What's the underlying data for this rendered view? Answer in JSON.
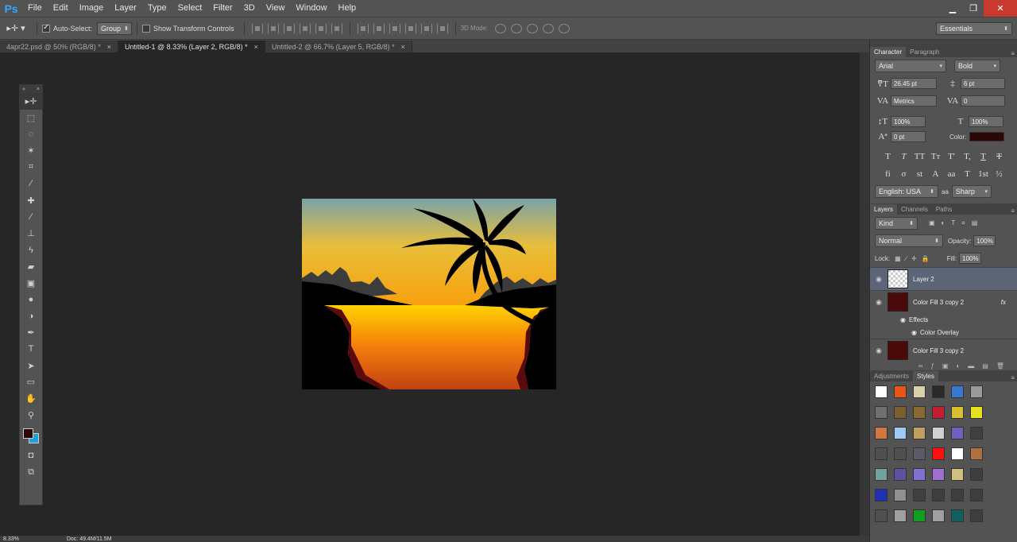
{
  "app": {
    "logo": "Ps"
  },
  "menu": [
    "File",
    "Edit",
    "Image",
    "Layer",
    "Type",
    "Select",
    "Filter",
    "3D",
    "View",
    "Window",
    "Help"
  ],
  "window_controls": {
    "minimize": "▁",
    "restore": "❐",
    "close": "✕"
  },
  "options": {
    "auto_select_label": "Auto-Select:",
    "auto_select_value": "Group",
    "transform_label": "Show Transform Controls",
    "mode3d_label": "3D Mode:",
    "workspace": "Essentials"
  },
  "tabs": [
    {
      "label": "4apr22.psd @ 50% (RGB/8) *"
    },
    {
      "label": "Untitled-1 @ 8.33% (Layer 2, RGB/8) *"
    },
    {
      "label": "Untitled-2 @ 66.7% (Layer 5, RGB/8) *"
    }
  ],
  "status": {
    "zoom": "8.33%",
    "doc": "Doc: 49.4M/11.5M"
  },
  "character": {
    "tabs": [
      "Character",
      "Paragraph"
    ],
    "font_family": "Arial",
    "font_style": "Bold",
    "size": "26.45 pt",
    "leading": "6 pt",
    "kerning": "Metrics",
    "tracking": "0",
    "vscale": "100%",
    "hscale": "100%",
    "baseline": "0 pt",
    "color_label": "Color:",
    "color": "#2c0707",
    "styles": [
      "T",
      "T",
      "TT",
      "Tт",
      "T'",
      "T,",
      "T",
      "T"
    ],
    "ligatures": [
      "fi",
      "σ",
      "st",
      "A",
      "aa",
      "T",
      "1st",
      "½"
    ],
    "language": "English: USA",
    "aa_label": "aa",
    "antialias": "Sharp"
  },
  "layers": {
    "tabs": [
      "Layers",
      "Channels",
      "Paths"
    ],
    "kind": "Kind",
    "blend": "Normal",
    "opacity_label": "Opacity:",
    "opacity": "100%",
    "lock_label": "Lock:",
    "fill_label": "Fill:",
    "fill": "100%",
    "items": [
      {
        "name": "Layer 2",
        "selected": true
      },
      {
        "name": "Color Fill 3 copy 2",
        "fx": "fx"
      },
      {
        "name": "Effects"
      },
      {
        "name": "Color Overlay"
      },
      {
        "name": "Color Fill 3 copy 2"
      }
    ]
  },
  "adjustments": {
    "tabs": [
      "Adjustments",
      "Styles"
    ]
  },
  "style_colors": [
    "#ffffff",
    "#e8541a",
    "#d8d0a8",
    "#2a2a2a",
    "#3a78d0",
    "#9a9a9a",
    "#707070",
    "#7a6030",
    "#8a6a30",
    "#c02030",
    "#d8c030",
    "#e8e020",
    "#d07840",
    "#a0c8f0",
    "#c0a060",
    "#d0d0d0",
    "#7060c0",
    "#404040",
    "#505050",
    "#505050",
    "#5a5a6a",
    "#ff1010",
    "#ffffff",
    "#b07040",
    "#70a0a0",
    "#6050a0",
    "#8070d0",
    "#a070d0",
    "#d0c080",
    "#3e3e3e",
    "#2030b0",
    "#909090",
    "#404040",
    "#3e3e3e",
    "#3e3e3e",
    "#3e3e3e",
    "#505050",
    "#a0a0a0",
    "#10a020",
    "#a0a0a0",
    "#106060",
    "#3e3e3e"
  ]
}
